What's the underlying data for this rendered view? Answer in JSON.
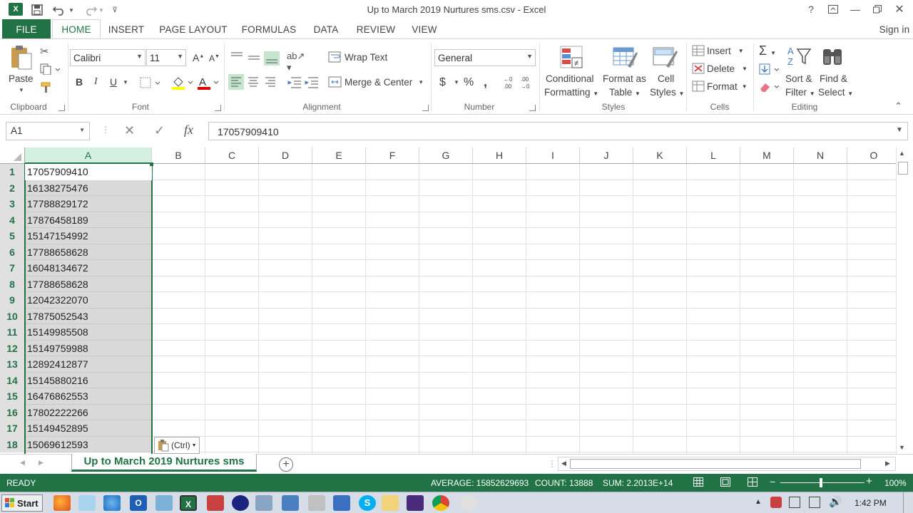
{
  "window": {
    "title": "Up to March 2019 Nurtures sms.csv - Excel",
    "signin": "Sign in"
  },
  "icons": {
    "app": "excel-logo-icon",
    "save": "save-icon",
    "undo": "undo-icon",
    "redo": "redo-icon",
    "help": "help-icon"
  },
  "tabs": [
    "FILE",
    "HOME",
    "INSERT",
    "PAGE LAYOUT",
    "FORMULAS",
    "DATA",
    "REVIEW",
    "VIEW"
  ],
  "ribbon": {
    "clipboard": {
      "paste": "Paste",
      "label": "Clipboard"
    },
    "font": {
      "name": "Calibri",
      "size": "11",
      "label": "Font",
      "bold": "B",
      "italic": "I",
      "underline": "U"
    },
    "alignment": {
      "wrap": "Wrap Text",
      "merge": "Merge & Center",
      "label": "Alignment"
    },
    "number": {
      "format": "General",
      "currency": "$",
      "percent": "%",
      "comma": ",",
      "label": "Number"
    },
    "styles": {
      "cond1": "Conditional",
      "cond2": "Formatting",
      "fmt1": "Format as",
      "fmt2": "Table",
      "cell1": "Cell",
      "cell2": "Styles",
      "label": "Styles"
    },
    "cells": {
      "insert": "Insert",
      "delete": "Delete",
      "format": "Format",
      "label": "Cells"
    },
    "editing": {
      "sort1": "Sort &",
      "sort2": "Filter",
      "find1": "Find &",
      "find2": "Select",
      "label": "Editing"
    }
  },
  "formula_bar": {
    "namebox": "A1",
    "fx": "fx",
    "value": "17057909410"
  },
  "columns": [
    "A",
    "B",
    "C",
    "D",
    "E",
    "F",
    "G",
    "H",
    "I",
    "J",
    "K",
    "L",
    "M",
    "N",
    "O"
  ],
  "rows": [
    {
      "n": "1",
      "a": "17057909410"
    },
    {
      "n": "2",
      "a": "16138275476"
    },
    {
      "n": "3",
      "a": "17788829172"
    },
    {
      "n": "4",
      "a": "17876458189"
    },
    {
      "n": "5",
      "a": "15147154992"
    },
    {
      "n": "6",
      "a": "17788658628"
    },
    {
      "n": "7",
      "a": "16048134672"
    },
    {
      "n": "8",
      "a": "17788658628"
    },
    {
      "n": "9",
      "a": "12042322070"
    },
    {
      "n": "10",
      "a": "17875052543"
    },
    {
      "n": "11",
      "a": "15149985508"
    },
    {
      "n": "12",
      "a": "15149759988"
    },
    {
      "n": "13",
      "a": "12892412877"
    },
    {
      "n": "14",
      "a": "15145880216"
    },
    {
      "n": "15",
      "a": "16476862553"
    },
    {
      "n": "16",
      "a": "17802222266"
    },
    {
      "n": "17",
      "a": "15149452895"
    },
    {
      "n": "18",
      "a": "15069612593"
    }
  ],
  "paste_options": "(Ctrl)",
  "sheet_tab": "Up to March 2019 Nurtures sms",
  "status": {
    "ready": "READY",
    "average": "AVERAGE: 15852629693",
    "count": "COUNT: 13888",
    "sum": "SUM: 2.2013E+14",
    "zoom": "100%"
  },
  "taskbar": {
    "start": "Start",
    "time": "1:42 PM"
  },
  "colors": {
    "accent": "#217346",
    "selection": "#d9d9d9"
  }
}
